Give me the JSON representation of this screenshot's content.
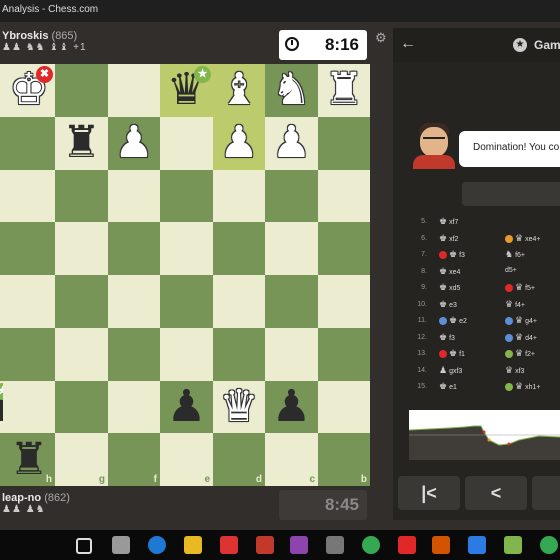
{
  "window": {
    "title": "Analysis - Chess.com"
  },
  "top_player": {
    "name": "Ybroskis",
    "rating": "(865)",
    "captured": "♟♟ ♞♞ ♝♝ +1",
    "clock": "8:16"
  },
  "bottom_player": {
    "name": "leap-no",
    "rating": "(862)",
    "captured": "♟♟ ♟♞",
    "clock": "8:45"
  },
  "board": {
    "files": [
      "",
      "h",
      "g",
      "f",
      "e",
      "d",
      "c",
      "b",
      "a"
    ],
    "rows": [
      [
        "",
        "wK",
        "",
        "",
        "bQ",
        "wB",
        "wN",
        "wR"
      ],
      [
        "",
        "",
        "bR",
        "wP",
        "",
        "wP",
        "wP",
        ""
      ],
      [
        "",
        "",
        "",
        "",
        "",
        "",
        "",
        ""
      ],
      [
        "",
        "",
        "",
        "",
        "",
        "",
        "",
        ""
      ],
      [
        "",
        "",
        "",
        "",
        "",
        "",
        "",
        ""
      ],
      [
        "",
        "",
        "",
        "",
        "",
        "",
        "",
        ""
      ],
      [
        "bP",
        "",
        "",
        "",
        "bP",
        "wQ",
        "bP",
        ""
      ],
      [
        "",
        "bR",
        "",
        "",
        "",
        "",
        "",
        ""
      ]
    ]
  },
  "panel": {
    "title": "Gam",
    "coach_message": "Domination! You co",
    "moves": [
      {
        "num": "5.",
        "white": "xf7",
        "black": ""
      },
      {
        "num": "6.",
        "white": "xf2",
        "black": "xe4+"
      },
      {
        "num": "7.",
        "white": "f3",
        "black": "f6+"
      },
      {
        "num": "8.",
        "white": "xe4",
        "black": "d5+"
      },
      {
        "num": "9.",
        "white": "xd5",
        "black": "f5+"
      },
      {
        "num": "10.",
        "white": "e3",
        "black": "f4+"
      },
      {
        "num": "11.",
        "white": "e2",
        "black": "g4+"
      },
      {
        "num": "12.",
        "white": "f3",
        "black": "d4+"
      },
      {
        "num": "13.",
        "white": "f1",
        "black": "f2+"
      },
      {
        "num": "14.",
        "white": "gxf3",
        "black": "xf3"
      },
      {
        "num": "15.",
        "white": "e1",
        "black": "xh1+"
      }
    ],
    "controls": {
      "first": "|<",
      "prev": "<"
    }
  }
}
